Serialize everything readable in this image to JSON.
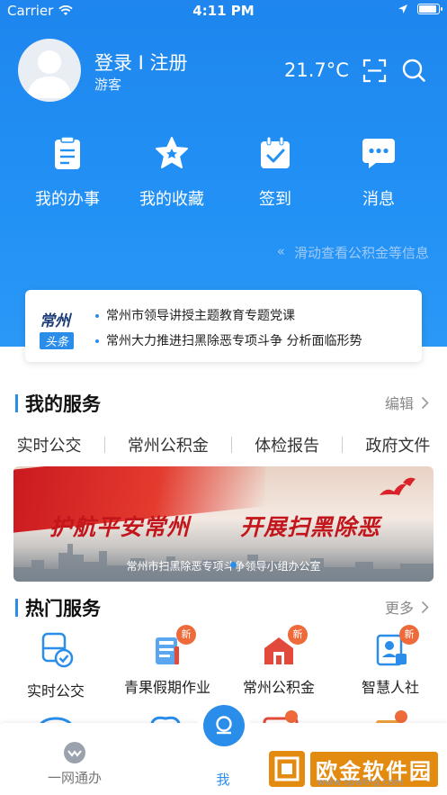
{
  "status_bar": {
    "carrier": "Carrier",
    "time": "4:11 PM",
    "battery_level": 1.0
  },
  "header": {
    "login_label": "登录 I 注册",
    "guest_label": "游客",
    "temperature": "21.7°C",
    "icons": [
      "avatar",
      "scan-icon",
      "search-icon"
    ]
  },
  "quick_actions": [
    {
      "label": "我的办事",
      "icon": "clipboard-icon"
    },
    {
      "label": "我的收藏",
      "icon": "star-icon"
    },
    {
      "label": "签到",
      "icon": "calendar-check-icon"
    },
    {
      "label": "消息",
      "icon": "chat-icon"
    }
  ],
  "swipe_hint": "滑动查看公积金等信息",
  "news": {
    "logo_line1": "常州",
    "logo_line2": "头条",
    "items": [
      "常州市领导讲授主题教育专题党课",
      "常州大力推进扫黑除恶专项斗争 分析面临形势"
    ]
  },
  "my_services": {
    "title": "我的服务",
    "edit_label": "编辑",
    "tabs": [
      "实时公交",
      "常州公积金",
      "体检报告",
      "政府文件"
    ]
  },
  "banner": {
    "slogan_left": "护航平安常州",
    "slogan_right": "开展扫黑除恶",
    "org": "常州市扫黑除恶专项斗争领导小组办公室"
  },
  "hot_services": {
    "title": "热门服务",
    "more_label": "更多",
    "badge": "新",
    "items": [
      {
        "label": "实时公交",
        "icon": "bus-icon",
        "badge": false
      },
      {
        "label": "青果假期作业",
        "icon": "homework-icon",
        "badge": true
      },
      {
        "label": "常州公积金",
        "icon": "fund-icon",
        "badge": true
      },
      {
        "label": "智慧人社",
        "icon": "id-card-icon",
        "badge": true
      }
    ]
  },
  "tab_bar": {
    "items": [
      {
        "label": "一网通办",
        "icon": "handshake-icon"
      },
      {
        "label": "我",
        "icon": "profile-icon"
      }
    ]
  },
  "watermark": {
    "text": "欧金软件园",
    "url": "www.spwtng.com"
  },
  "colors": {
    "primary": "#2291f5",
    "accent": "#2a8de9",
    "badge": "#ee6a3a",
    "banner_red": "#c2161c"
  }
}
